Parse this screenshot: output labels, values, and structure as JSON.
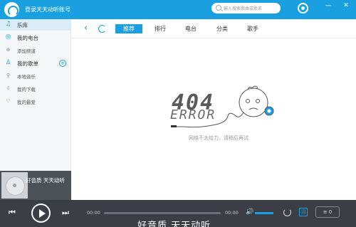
{
  "titlebar": {
    "login_text": "登录天天动听账号",
    "search_placeholder": "输入搜索歌曲或歌名",
    "minimize": "—",
    "close": "✕"
  },
  "sidebar": {
    "items": [
      {
        "label": "乐库",
        "icon": "music-note-icon"
      },
      {
        "label": "我的电台",
        "icon": "radio-icon"
      },
      {
        "label": "添加频道",
        "icon": "add-channel-icon"
      },
      {
        "label": "我的歌单",
        "icon": "user-icon"
      },
      {
        "label": "本地音乐",
        "icon": "location-icon"
      },
      {
        "label": "我的下载",
        "icon": "download-icon"
      },
      {
        "label": "我的最爱",
        "icon": "heart-icon"
      }
    ],
    "now_playing": {
      "title": "好音质 天天动听"
    }
  },
  "nav": {
    "tabs": [
      {
        "label": "推荐",
        "active": true
      },
      {
        "label": "排行",
        "active": false
      },
      {
        "label": "电台",
        "active": false
      },
      {
        "label": "分类",
        "active": false
      },
      {
        "label": "歌手",
        "active": false
      }
    ]
  },
  "error": {
    "code": "404",
    "word": "ERROR",
    "message": "网络不太给力，请稍后再试"
  },
  "player": {
    "current_time": "00:00",
    "total_time": "00:00",
    "progress": 0,
    "volume": 1.0,
    "lyric_label": "词",
    "slogan": "好音质 天天动听"
  },
  "colors": {
    "accent": "#1aa0e0",
    "player_bg": "#3b3e45"
  }
}
